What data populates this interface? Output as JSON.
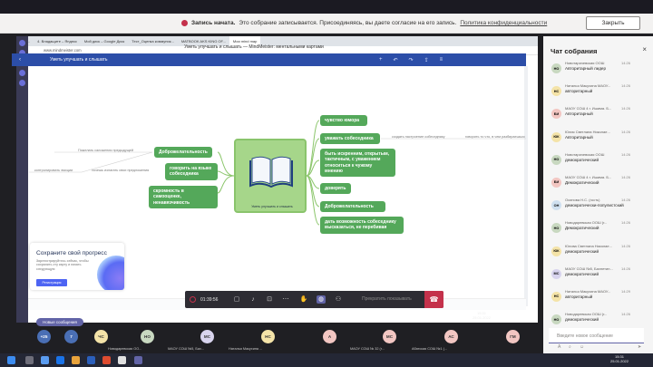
{
  "banner": {
    "title": "Запись начата.",
    "message": "Это собрание записывается. Присоединяясь, вы даете согласие на его запись.",
    "policy_link": "Политика конфиденциальности",
    "close_label": "Закрыть"
  },
  "browser": {
    "tabs": [
      "Мои...",
      "4. Владащите – Яндекс",
      "Мой диск – Google Диск",
      "Тест_Оценка коммуник...",
      "MATBOOK AKS KING OF...",
      "Мои mind map"
    ],
    "url": "www.mindmeister.com",
    "page_title": "Уметь улучшать и слышать — MindMeister: ментальными картами"
  },
  "mindmeister": {
    "map_title": "Уметь улучшать и слышать"
  },
  "mindmap": {
    "center": "Уметь улучшать и слышать",
    "left_nodes": [
      "Доброжелательность",
      "говорить на языке собеседника",
      "скромность в самооценке, ненавязчивость"
    ],
    "right_nodes": [
      "чувство юмора",
      "уважать собеседника",
      "быть искренним, открытым, тактичным, с уважением относиться к чужому мнению",
      "доверять",
      "Доброжелательность",
      "дать возможность собеседнику высказаться, не перебивая"
    ],
    "leaves": [
      "Пожелать изложения предыдущей",
      "контролировать эмоции",
      "хочешь излагать свои предложения",
      "создать настроение собеседнику",
      "говорить то что, в чем разбираешься"
    ]
  },
  "promo": {
    "title": "Сохраните свой прогресс",
    "text": "Зарегистрируйтесь сейчас, чтобы сохранить эту карту и начать следующую",
    "button": "Регистрация"
  },
  "meeting": {
    "timer": "01:39:56",
    "stop_sharing": "Прекратить показывать"
  },
  "chat": {
    "title": "Чат собрания",
    "messages": [
      {
        "initials": "НО",
        "name": "Новотаричевская ООШ",
        "time": "14:26",
        "text": "Авторитарный лидер",
        "color": "#c8d8c0"
      },
      {
        "initials": "НС",
        "name": "Наталья Макухина МАОУ...",
        "time": "14:26",
        "text": "авторитарный",
        "color": "#f4e3a8"
      },
      {
        "initials": "БИ",
        "name": "МАОУ СОШ 4 г. Ишима. Б...",
        "time": "14:26",
        "text": "Авторитарный",
        "color": "#f2c6c2"
      },
      {
        "initials": "ЮК",
        "name": "Юлия Светлана Николае...",
        "time": "14:26",
        "text": "Авторитарный",
        "color": "#f4e3a8"
      },
      {
        "initials": "НО",
        "name": "Новотаричевская ООШ",
        "time": "14:26",
        "text": "демократический",
        "color": "#c8d8c0"
      },
      {
        "initials": "БИ",
        "name": "МАОУ СОШ 4 г. Ишима. Б...",
        "time": "14:26",
        "text": "Демократический",
        "color": "#f2c6c2"
      },
      {
        "initials": "ОН",
        "name": "Осипова Н.С. (гость)",
        "time": "14:26",
        "text": "демократически-популистский",
        "color": "#cfe0f0"
      },
      {
        "initials": "НО",
        "name": "Новодаревская ООШ (г...",
        "time": "14:26",
        "text": "Демократический",
        "color": "#c8d8c0"
      },
      {
        "initials": "ЮК",
        "name": "Юлова Светлана Николае...",
        "time": "14:26",
        "text": "демократический",
        "color": "#f4e3a8"
      },
      {
        "initials": "МС",
        "name": "МАОУ СОШ №5, Бахнетин...",
        "time": "14:26",
        "text": "демократический",
        "color": "#d8d4ee"
      },
      {
        "initials": "НС",
        "name": "Наталья Макухина МАОУ...",
        "time": "14:29",
        "text": "авторитарный",
        "color": "#f4e3a8"
      },
      {
        "initials": "НО",
        "name": "Новодаревская ООШ (г...",
        "time": "14:26",
        "text": "демократический",
        "color": "#c8d8c0"
      }
    ],
    "new_messages": "Новые сообщения",
    "compose_placeholder": "Введите новое сообщение"
  },
  "participants": [
    {
      "initials": "+25",
      "label": "",
      "color": "#4a6fb5"
    },
    {
      "initials": "7",
      "label": "",
      "color": "#4a6fb5"
    },
    {
      "initials": "ЧС",
      "label": "",
      "color": "#f4e3a8"
    },
    {
      "initials": "НО",
      "label": "Новодаревская ОО...",
      "color": "#c8d8c0"
    },
    {
      "initials": "МС",
      "label": "МАОУ СОШ №5, Бах...",
      "color": "#d8d4ee"
    },
    {
      "initials": "НС",
      "label": "Наталья Макухина ...",
      "color": "#f4e3a8"
    },
    {
      "initials": "А",
      "label": "",
      "color": "#f2c6c2"
    },
    {
      "initials": "МС",
      "label": "МАОУ СОШ № 32 (г...",
      "color": "#f2c6c2"
    },
    {
      "initials": "АС",
      "label": "Абатская СОШ №1 (...",
      "color": "#f2c6c2"
    },
    {
      "initials": "ГМ",
      "label": "",
      "color": "#f2c6c2"
    }
  ],
  "screen_clock": {
    "time": "15:31",
    "date": "25.01.2022"
  },
  "clock": {
    "time": "15:31",
    "date": "25.01.2022"
  }
}
